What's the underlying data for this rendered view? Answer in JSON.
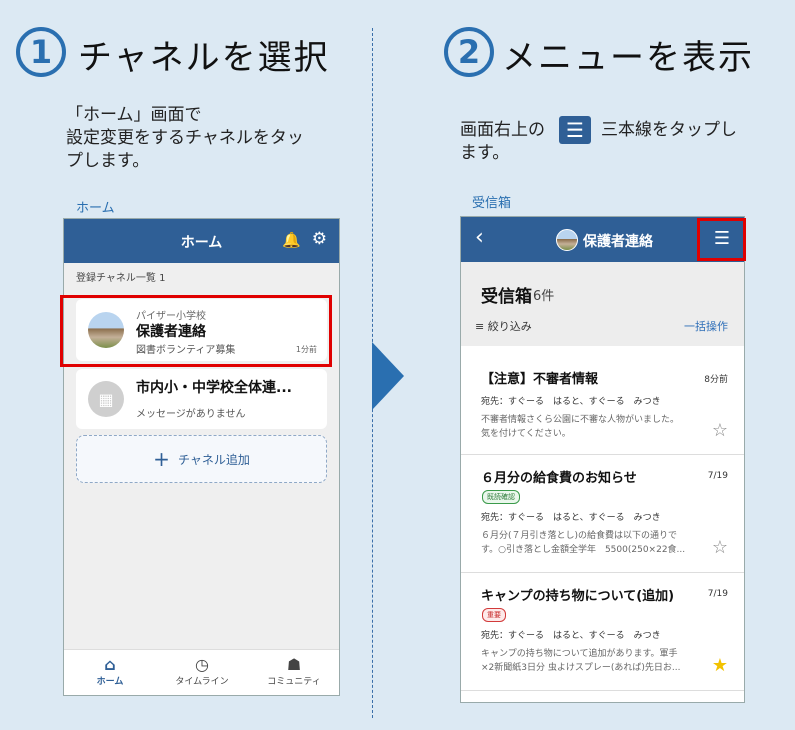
{
  "step1": {
    "num": "1",
    "title": "チャネルを選択",
    "instruction": "「ホーム」画面で\n 設定変更をするチャネルをタッ\n プします。",
    "caption": "ホーム"
  },
  "step2": {
    "num": "2",
    "title": "メニューを表示",
    "instruction_before": "画面右上の",
    "instruction_after": "三本線をタップし",
    "instruction_line2": "ます。",
    "caption": "受信箱"
  },
  "phone1": {
    "header_title": "ホーム",
    "bell_icon": "🔔",
    "gear_icon": "⚙",
    "list_label": "登録チャネル一覧 1",
    "channels": [
      {
        "school": "パイザー小学校",
        "name": "保護者連絡",
        "last_message": "図書ボランティア募集",
        "time": "1分前"
      },
      {
        "name": "市内小・中学校全体連...",
        "last_message": "メッセージがありません"
      }
    ],
    "add_button_plus": "+",
    "add_button": "チャネル追加",
    "tabs": [
      {
        "icon": "⌂",
        "label": "ホーム"
      },
      {
        "icon": "◷",
        "label": "タイムライン"
      },
      {
        "icon": "☗",
        "label": "コミュニティ"
      }
    ]
  },
  "phone2": {
    "back_icon": "‹",
    "header_title": "保護者連絡",
    "menu_icon": "☰",
    "inbox_title": "受信箱",
    "inbox_count": "6件",
    "filter_label": "≡ 絞り込み",
    "bulk_action": "一括操作",
    "messages": [
      {
        "title": "【注意】不審者情報",
        "date": "8分前",
        "to": "宛先：すぐーる　はると、すぐーる　みつき",
        "body": "不審者情報さくら公園に不審な人物がいました。\n気を付けてください。",
        "star": "☆"
      },
      {
        "title": "６月分の給食費のお知らせ",
        "date": "7/19",
        "badge": "既読確認",
        "to": "宛先：すぐーる　はると、すぐーる　みつき",
        "body": "６月分(７月引き落とし)の給食費は以下の通りで\nす。○引き落とし金額全学年　5500(250×22食...",
        "star": "☆"
      },
      {
        "title": "キャンプの持ち物について(追加)",
        "date": "7/19",
        "badge": "重要",
        "to": "宛先：すぐーる　はると、すぐーる　みつき",
        "body": "キャンプの持ち物について追加があります。軍手\n×2新聞紙3日分 虫よけスプレー(あれば)先日お...",
        "star": "★"
      }
    ]
  },
  "colors": {
    "accent": "#2a6fb0",
    "header": "#2f5f96",
    "highlight": "#e00000",
    "background": "#dce9f3"
  }
}
